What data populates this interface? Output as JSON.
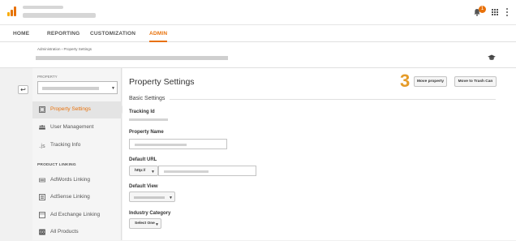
{
  "nav": {
    "tabs": [
      {
        "label": "HOME"
      },
      {
        "label": "REPORTING"
      },
      {
        "label": "CUSTOMIZATION"
      },
      {
        "label": "ADMIN"
      }
    ],
    "active_tab": "ADMIN"
  },
  "topbar": {
    "notification_count": "1",
    "icons": [
      "analytics-logo-icon",
      "bell-icon",
      "apps-grid-icon",
      "more-vert-icon"
    ]
  },
  "header": {
    "breadcrumb": "Administration › Property Settings",
    "icons": [
      "graduation-cap-icon"
    ]
  },
  "sidebar": {
    "property_label": "PROPERTY",
    "items": [
      {
        "label": "Property Settings",
        "icon": "property-settings-icon",
        "active": true
      },
      {
        "label": "User Management",
        "icon": "users-icon"
      },
      {
        "label": "Tracking Info",
        "icon": "tracking-js-icon"
      }
    ],
    "section_label": "PRODUCT LINKING",
    "linking_items": [
      {
        "label": "AdWords Linking",
        "icon": "adwords-icon"
      },
      {
        "label": "AdSense Linking",
        "icon": "adsense-icon"
      },
      {
        "label": "Ad Exchange Linking",
        "icon": "ad-exchange-icon"
      },
      {
        "label": "All Products",
        "icon": "all-products-icon"
      }
    ]
  },
  "main": {
    "title": "Property Settings",
    "step_number": "3",
    "move_property_label": "Move property",
    "trash_label": "Move to Trash Can",
    "section_title": "Basic Settings",
    "tracking_id_label": "Tracking Id",
    "property_name_label": "Property Name",
    "default_url_label": "Default URL",
    "protocol_value": "http://",
    "default_view_label": "Default View",
    "industry_category_label": "Industry Category",
    "industry_category_value": "Select One"
  },
  "colors": {
    "accent": "#e8710a",
    "step_number": "#e59b28",
    "logo_bars": [
      "#f9ab00",
      "#e37400",
      "#e8710a"
    ]
  }
}
